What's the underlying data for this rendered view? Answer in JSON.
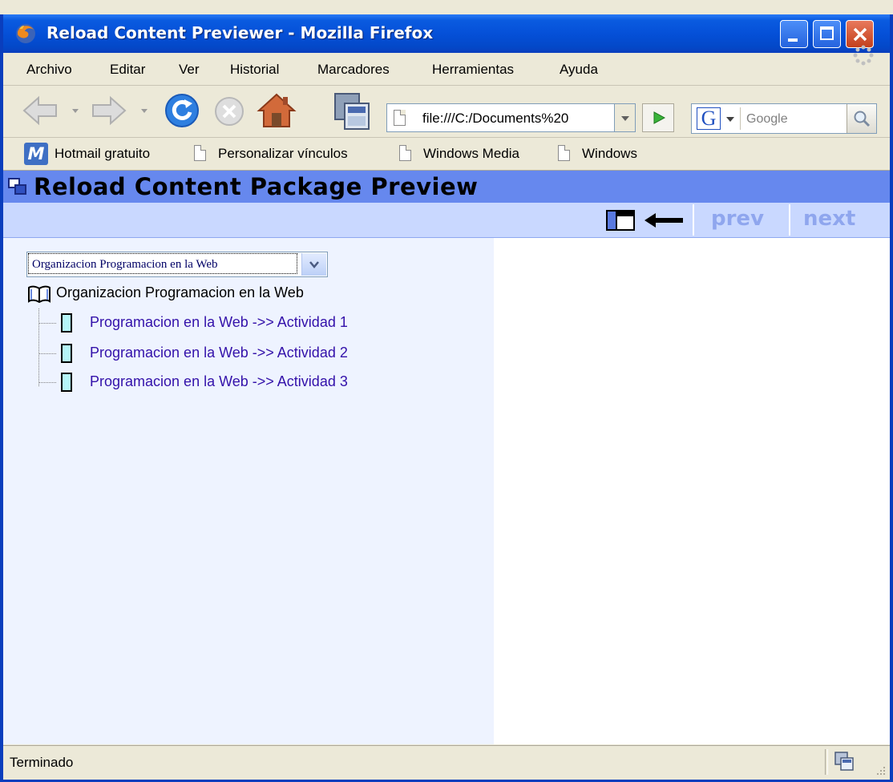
{
  "window": {
    "title": "Reload Content Previewer - Mozilla Firefox"
  },
  "menubar": {
    "items": [
      "Archivo",
      "Editar",
      "Ver",
      "Historial",
      "Marcadores",
      "Herramientas",
      "Ayuda"
    ]
  },
  "navigation": {
    "url": "file:///C:/Documents%20",
    "search_placeholder": "Google",
    "search_engine_icon": "G"
  },
  "bookmarks": {
    "items": [
      "Hotmail gratuito",
      "Personalizar vínculos",
      "Windows Media",
      "Windows"
    ]
  },
  "page": {
    "banner_title": "Reload Content Package Preview",
    "prev_label": "prev",
    "next_label": "next",
    "organization_select": "Organizacion Programacion en la Web",
    "tree_root": "Organizacion Programacion en la Web",
    "tree_items": [
      "Programacion en la Web ->> Actividad 1",
      "Programacion en la Web ->> Actividad 2",
      "Programacion en la Web ->> Actividad 3"
    ]
  },
  "status": {
    "text": "Terminado"
  },
  "colors": {
    "titlebar": "#0550d8",
    "banner": "#6688ee",
    "toolstrip": "#c9d8ff",
    "left_pane": "#eef3ff",
    "tree_link": "#3311aa",
    "nav_text_disabled": "#8fa6ee"
  }
}
